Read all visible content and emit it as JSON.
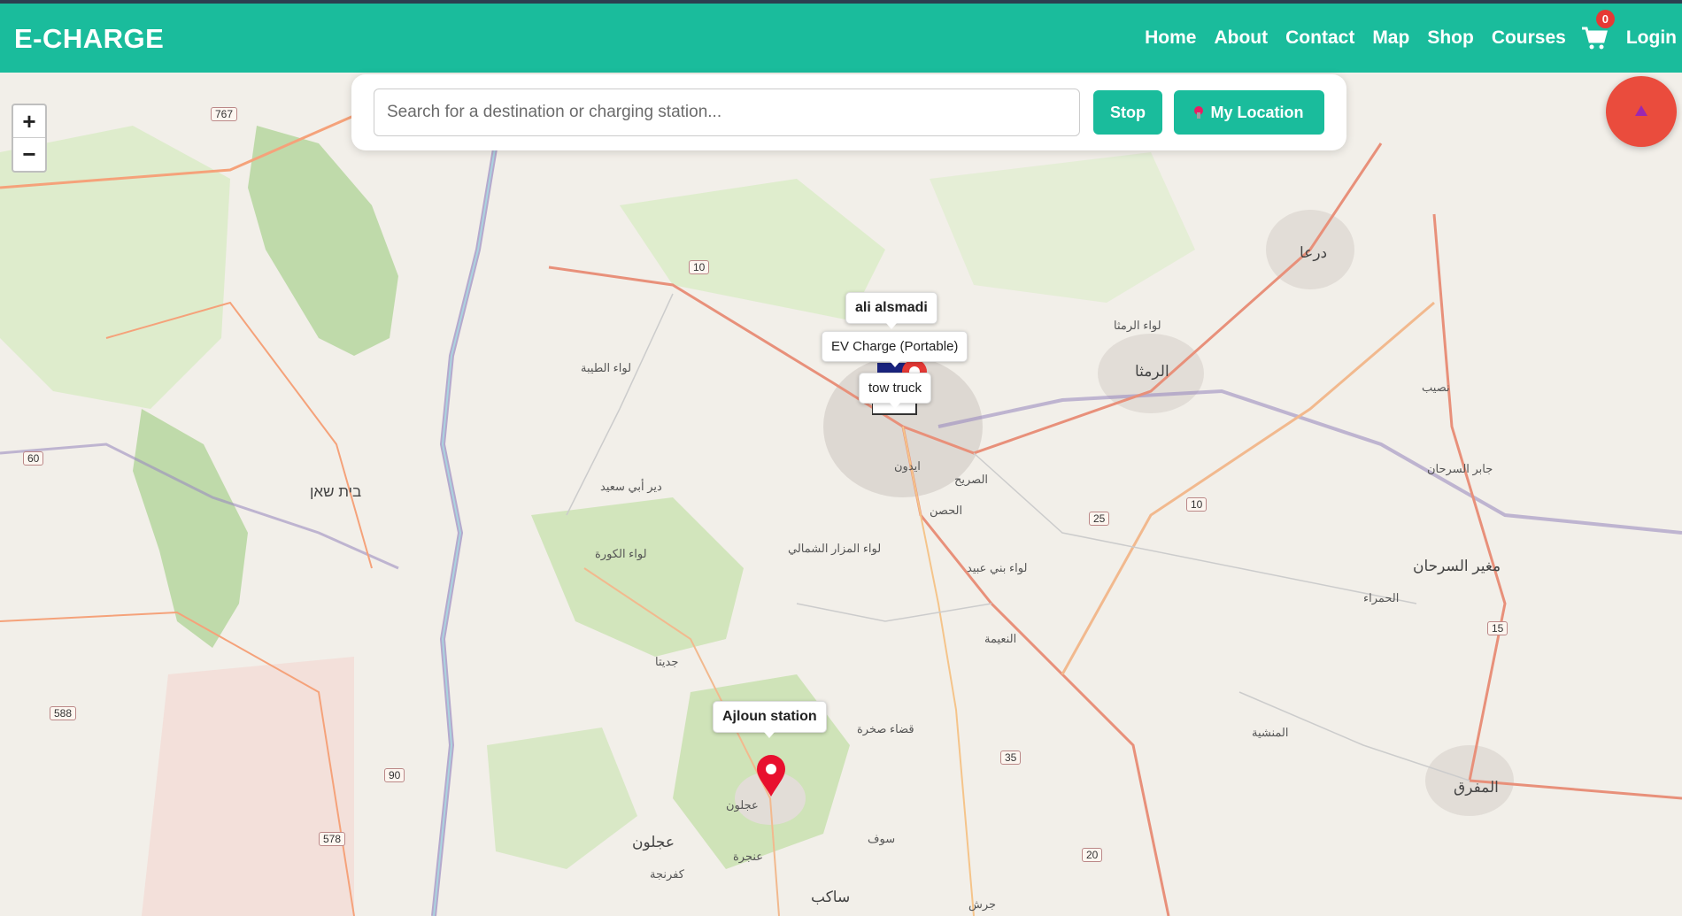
{
  "brand": {
    "name": "E-CHARGE"
  },
  "nav": {
    "links": [
      "Home",
      "About",
      "Contact",
      "Map",
      "Shop",
      "Courses"
    ],
    "cart_count": "0",
    "login": "Login"
  },
  "search": {
    "placeholder": "Search for a destination or charging station...",
    "stop_label": "Stop",
    "location_label": "My Location"
  },
  "zoom": {
    "in": "+",
    "out": "−"
  },
  "markers": {
    "ali": "ali alsmadi",
    "ev": "EV Charge (Portable)",
    "tow": "tow truck",
    "ajloun": "Ajloun station"
  },
  "map_labels": {
    "ramtha": "الرمثا",
    "daraa": "درعا",
    "irbid_area": "ايدون",
    "husn": "الحصن",
    "sarih": "الصريح",
    "ajloun": "عجلون",
    "ajloun2": "عجلون",
    "mafraq": "المفرق",
    "sarhan": "مغير السرحان",
    "koura": "لواء الكورة",
    "mazar": "لواء المزار الشمالي",
    "taybeh": "لواء الطيبة",
    "bani_obaid": "لواء بني عبيد",
    "ramtha_dist": "لواء الرمثا",
    "beit_shean": "בית שאן",
    "sakib": "ساكب",
    "deir_abi_said": "دير أبي سعيد",
    "nuaymeh": "النعيمة",
    "mansheyeh": "المنشية",
    "souf": "سوف",
    "jarash": "جرش",
    "anjara": "عنجرة",
    "kufranjah": "كفرنجة",
    "jdeita": "جديتا",
    "sakhra": "قضاء صخرة",
    "nuaymeh2": "النعيمة",
    "hamra": "الحمراء",
    "jaber": "جابر السرحان",
    "busayra": "نصيب"
  },
  "road_numbers": [
    "767",
    "10",
    "60",
    "588",
    "90",
    "578",
    "10",
    "25",
    "35",
    "20",
    "15",
    "25"
  ]
}
